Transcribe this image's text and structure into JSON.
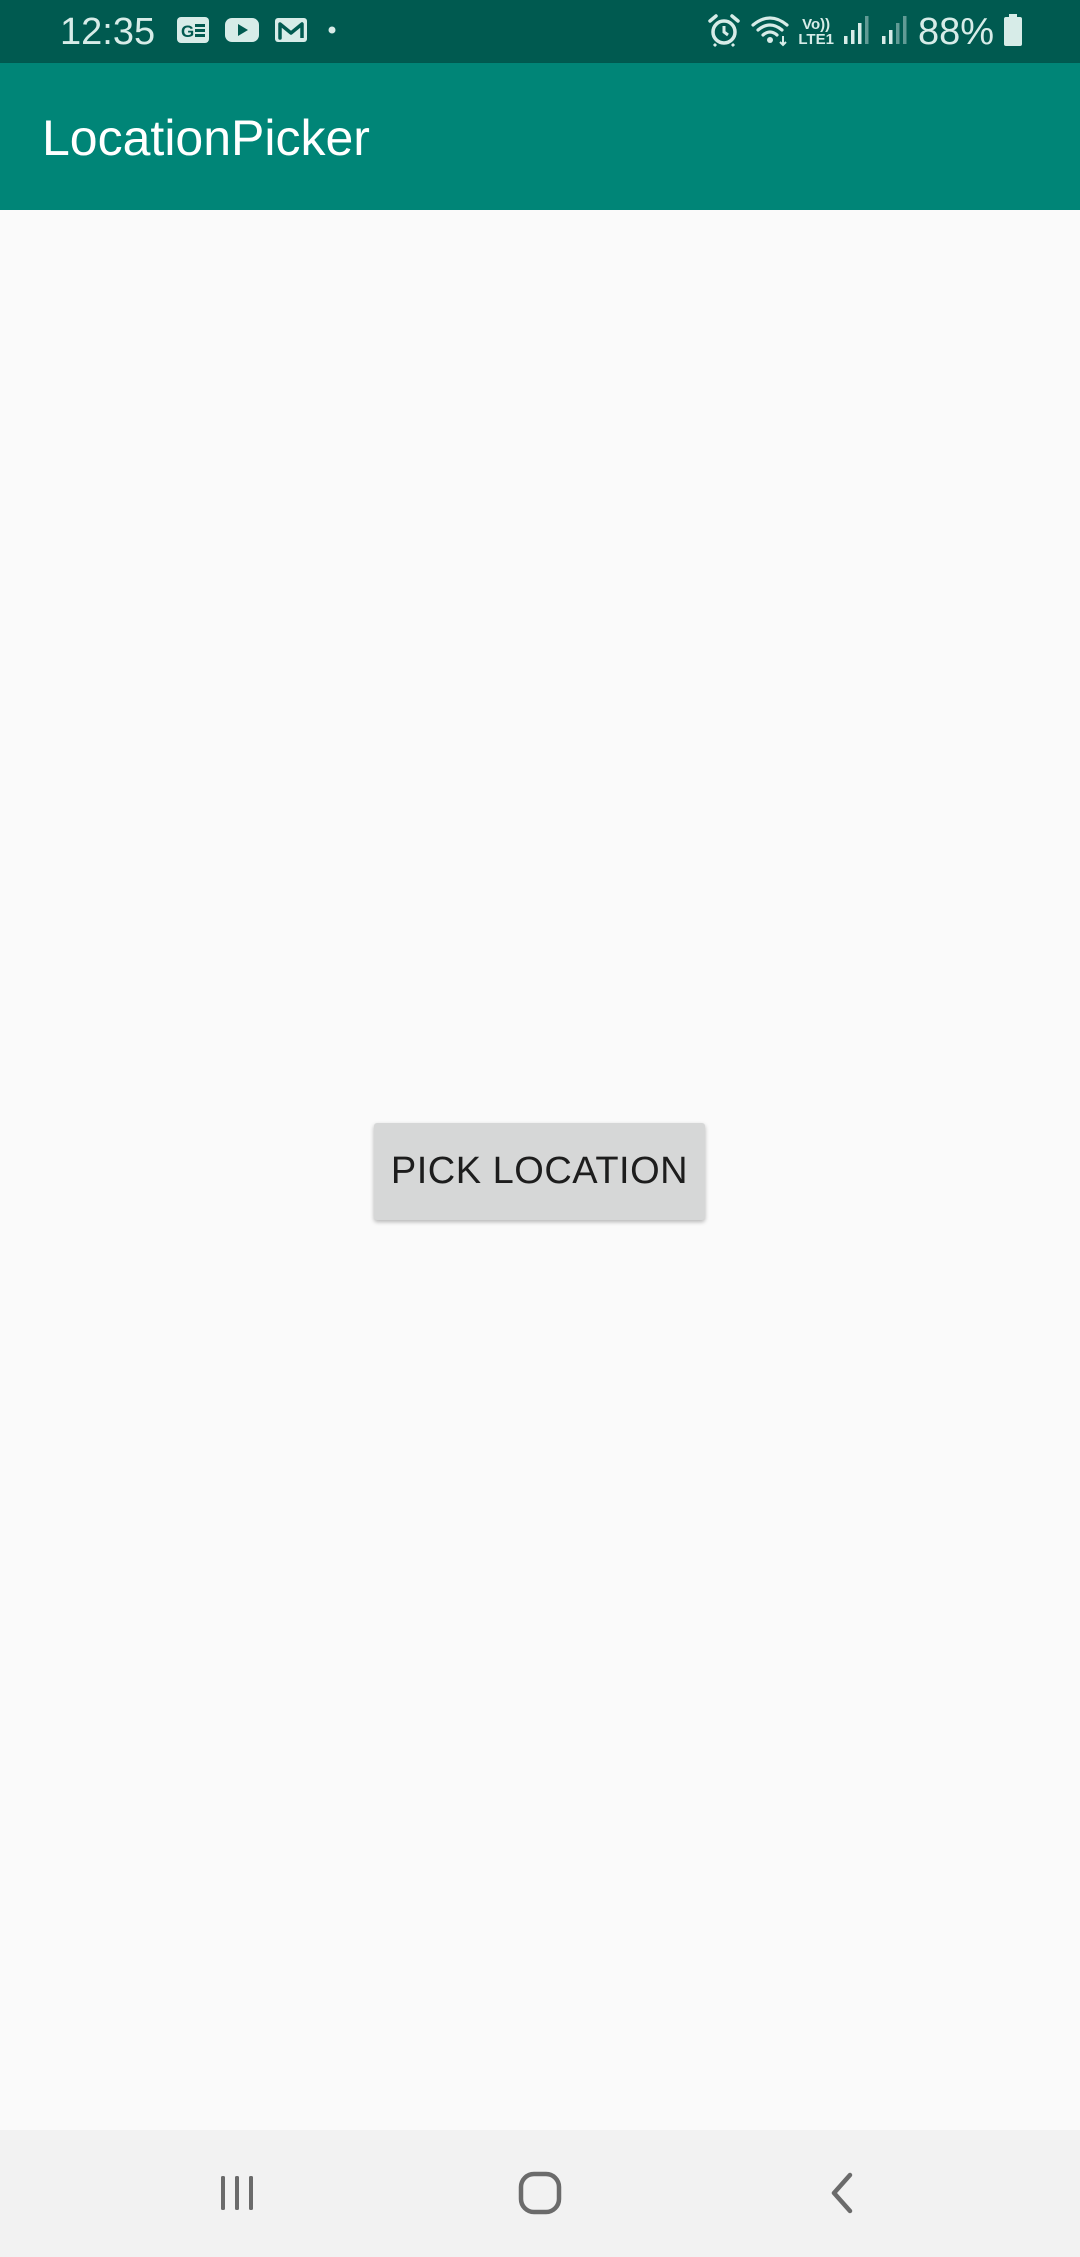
{
  "status_bar": {
    "time": "12:35",
    "battery_percent": "88%",
    "network_label_top": "Vo))",
    "network_label_bottom": "LTE1",
    "icons": [
      "google-news-icon",
      "youtube-icon",
      "gmail-icon",
      "notification-dot-icon",
      "alarm-icon",
      "wifi-icon",
      "signal-icon",
      "signal-icon-2",
      "battery-icon"
    ],
    "background_color": "#005a50"
  },
  "app_bar": {
    "title": "LocationPicker",
    "background_color": "#008577"
  },
  "main": {
    "pick_button_label": "PICK LOCATION"
  },
  "nav_bar": {
    "buttons": [
      "recent-apps-icon",
      "home-icon",
      "back-icon"
    ]
  }
}
